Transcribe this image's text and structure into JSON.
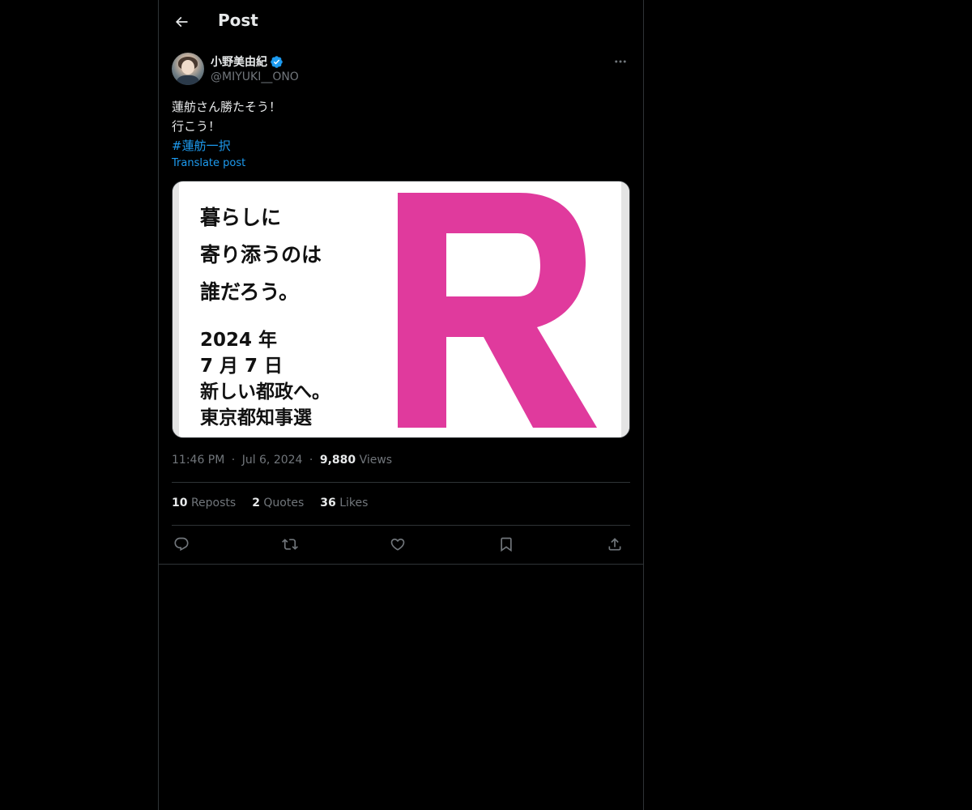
{
  "header": {
    "title": "Post"
  },
  "author": {
    "display_name": "小野美由紀",
    "handle": "@MIYUKI__ONO",
    "verified": true
  },
  "tweet": {
    "lines": [
      "蓮舫さん勝たそう！",
      "行こう！"
    ],
    "hashtag": "#蓮舫一択",
    "translate_label": "Translate post"
  },
  "media": {
    "lines_top": [
      "暮らしに",
      "寄り添うのは",
      "誰だろう。"
    ],
    "lines_bottom": [
      "2024 年",
      "7 月 7 日",
      "新しい都政へ。",
      "東京都知事選"
    ],
    "logo_letter": "R",
    "logo_color": "#e03a9d"
  },
  "meta": {
    "time": "11:46 PM",
    "date": "Jul 6, 2024",
    "sep": "·",
    "views_count": "9,880",
    "views_label": "Views"
  },
  "stats": {
    "reposts_count": "10",
    "reposts_label": "Reposts",
    "quotes_count": "2",
    "quotes_label": "Quotes",
    "likes_count": "36",
    "likes_label": "Likes"
  },
  "colors": {
    "background": "#000000",
    "text": "#e7e9ea",
    "muted": "#71767b",
    "accent": "#1d9bf0",
    "border": "#2f3336"
  },
  "icons": {
    "back": "arrow-left-icon",
    "verified": "verified-badge-icon",
    "more": "more-icon",
    "reply": "reply-icon",
    "repost": "repost-icon",
    "like": "heart-icon",
    "bookmark": "bookmark-icon",
    "share": "share-icon"
  }
}
